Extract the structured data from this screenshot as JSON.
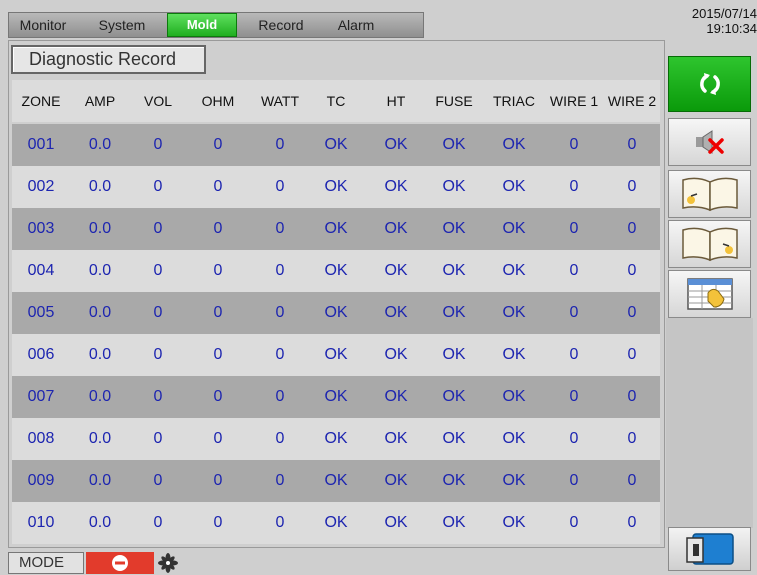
{
  "tabs": [
    {
      "label": "Monitor",
      "active": false
    },
    {
      "label": "System",
      "active": false
    },
    {
      "label": "Mold",
      "active": true
    },
    {
      "label": "Record",
      "active": false
    },
    {
      "label": "Alarm",
      "active": false
    }
  ],
  "datetime": {
    "date": "2015/07/14",
    "time": "19:10:34"
  },
  "page_title": "Diagnostic Record",
  "table": {
    "columns": [
      "ZONE",
      "AMP",
      "VOL",
      "OHM",
      "WATT",
      "TC",
      "HT",
      "FUSE",
      "TRIAC",
      "WIRE 1",
      "WIRE 2"
    ],
    "rows": [
      [
        "001",
        "0.0",
        "0",
        "0",
        "0",
        "OK",
        "OK",
        "OK",
        "OK",
        "0",
        "0"
      ],
      [
        "002",
        "0.0",
        "0",
        "0",
        "0",
        "OK",
        "OK",
        "OK",
        "OK",
        "0",
        "0"
      ],
      [
        "003",
        "0.0",
        "0",
        "0",
        "0",
        "OK",
        "OK",
        "OK",
        "OK",
        "0",
        "0"
      ],
      [
        "004",
        "0.0",
        "0",
        "0",
        "0",
        "OK",
        "OK",
        "OK",
        "OK",
        "0",
        "0"
      ],
      [
        "005",
        "0.0",
        "0",
        "0",
        "0",
        "OK",
        "OK",
        "OK",
        "OK",
        "0",
        "0"
      ],
      [
        "006",
        "0.0",
        "0",
        "0",
        "0",
        "OK",
        "OK",
        "OK",
        "OK",
        "0",
        "0"
      ],
      [
        "007",
        "0.0",
        "0",
        "0",
        "0",
        "OK",
        "OK",
        "OK",
        "OK",
        "0",
        "0"
      ],
      [
        "008",
        "0.0",
        "0",
        "0",
        "0",
        "OK",
        "OK",
        "OK",
        "OK",
        "0",
        "0"
      ],
      [
        "009",
        "0.0",
        "0",
        "0",
        "0",
        "OK",
        "OK",
        "OK",
        "OK",
        "0",
        "0"
      ],
      [
        "010",
        "0.0",
        "0",
        "0",
        "0",
        "OK",
        "OK",
        "OK",
        "OK",
        "0",
        "0"
      ]
    ]
  },
  "side_buttons": [
    {
      "icon": "refresh-icon"
    },
    {
      "icon": "mute-icon"
    },
    {
      "icon": "book-previous-icon"
    },
    {
      "icon": "book-next-icon"
    },
    {
      "icon": "table-select-icon"
    }
  ],
  "exit_icon": "exit-icon",
  "status_bar": {
    "mode_label": "MODE",
    "stop_icon": "stop-icon",
    "fan_icon": "fan-icon"
  },
  "colors": {
    "active_tab": "#1fae1f",
    "value_text": "#1d25b0",
    "stop": "#e23b2c"
  }
}
